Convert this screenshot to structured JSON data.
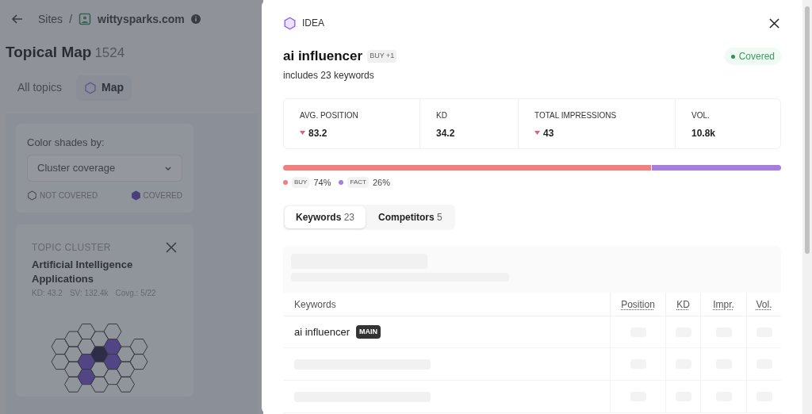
{
  "breadcrumb": {
    "root": "Sites",
    "separator": "/",
    "site": "wittysparks.com"
  },
  "page": {
    "title": "Topical Map",
    "count": "1524"
  },
  "view_tabs": [
    {
      "label": "All topics",
      "selected": false,
      "kind": "plain"
    },
    {
      "label": "Map",
      "selected": true,
      "kind": "hex"
    }
  ],
  "color_shades": {
    "label": "Color shades by:",
    "value": "Cluster coverage",
    "legend": [
      {
        "label": "NOT COVERED",
        "kind": "outline"
      },
      {
        "label": "COVERED",
        "kind": "filled"
      }
    ]
  },
  "topic_cluster": {
    "eyebrow": "TOPIC CLUSTER",
    "title": "Artificial Intelligence Applications",
    "stats": [
      "KD: 43.2",
      "SV: 132.4k",
      "Covg.: 5/22"
    ]
  },
  "panel": {
    "type": "IDEA",
    "title": "ai influencer",
    "tag": "BUY +1",
    "subtitle": "includes 23 keywords",
    "status": "Covered"
  },
  "metrics": [
    {
      "label": "AVG. POSITION",
      "value": "83.2",
      "falling": true
    },
    {
      "label": "KD",
      "value": "34.2"
    },
    {
      "label": "TOTAL IMPRESSIONS",
      "value": "43",
      "falling": true
    },
    {
      "label": "VOL.",
      "value": "10.8k"
    }
  ],
  "intents": [
    {
      "label": "BUY",
      "share": "74%",
      "color": "#f07f7f"
    },
    {
      "label": "FACT",
      "share": "26%",
      "color": "#a57ee0"
    }
  ],
  "detail_tabs": [
    {
      "label": "Keywords",
      "count": "23",
      "selected": true
    },
    {
      "label": "Competitors",
      "count": "5",
      "selected": false
    }
  ],
  "table": {
    "columns": [
      "Keywords",
      "Position",
      "KD",
      "Impr.",
      "Vol."
    ],
    "rows": [
      {
        "kind": "keyword",
        "keyword": "ai influencer",
        "badge": "MAIN"
      },
      {
        "kind": "loading"
      },
      {
        "kind": "loading"
      }
    ]
  }
}
